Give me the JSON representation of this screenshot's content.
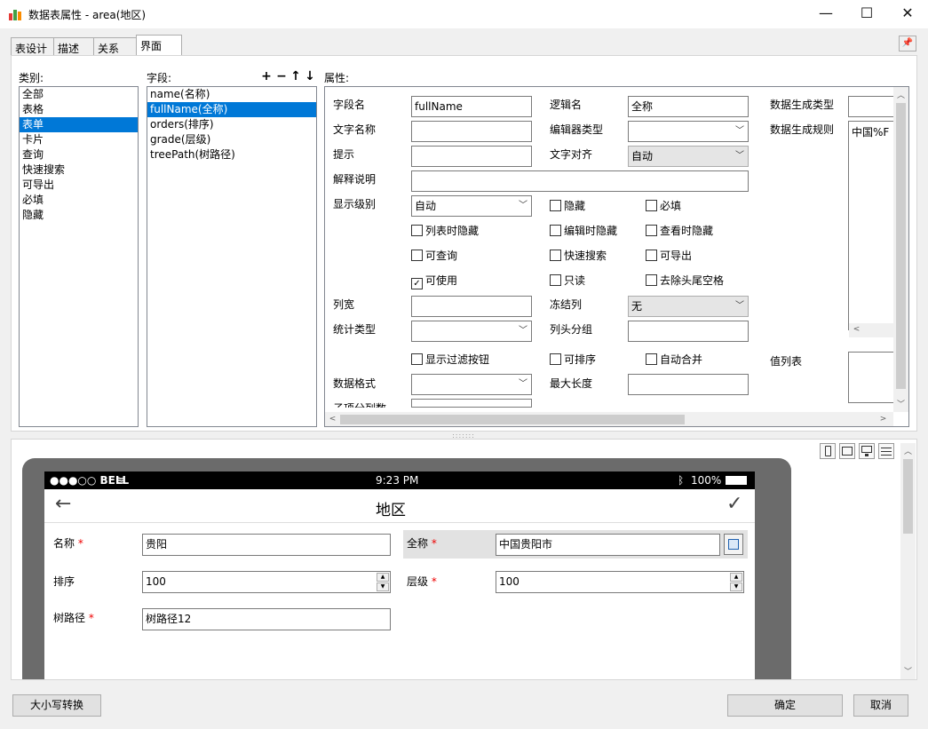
{
  "window": {
    "title": "数据表属性 - area(地区)"
  },
  "tabs": [
    {
      "label": "表设计"
    },
    {
      "label": "描述"
    },
    {
      "label": "关系"
    },
    {
      "label": "界面"
    }
  ],
  "category": {
    "label": "类别:",
    "items": [
      {
        "label": "全部"
      },
      {
        "label": "表格"
      },
      {
        "label": "表单"
      },
      {
        "label": "卡片"
      },
      {
        "label": "查询"
      },
      {
        "label": "快速搜索"
      },
      {
        "label": "可导出"
      },
      {
        "label": "必填"
      },
      {
        "label": "隐藏"
      }
    ],
    "selected_index": 2
  },
  "fields": {
    "label": "字段:",
    "items": [
      {
        "label": "name(名称)"
      },
      {
        "label": "fullName(全称)"
      },
      {
        "label": "orders(排序)"
      },
      {
        "label": "grade(层级)"
      },
      {
        "label": "treePath(树路径)"
      }
    ],
    "selected_index": 1,
    "toolbar": {
      "add": "+",
      "remove": "−",
      "up": "↑",
      "down": "↓"
    }
  },
  "props": {
    "label": "属性:",
    "field_name": {
      "label": "字段名",
      "value": "fullName"
    },
    "logic_name": {
      "label": "逻辑名",
      "value": "全称"
    },
    "gen_type": {
      "label": "数据生成类型",
      "value": ""
    },
    "text_name": {
      "label": "文字名称",
      "value": ""
    },
    "editor_type": {
      "label": "编辑器类型",
      "value": ""
    },
    "gen_rule": {
      "label": "数据生成规则",
      "value": "中国%F"
    },
    "hint": {
      "label": "提示",
      "value": ""
    },
    "text_align": {
      "label": "文字对齐",
      "value": "自动"
    },
    "explain": {
      "label": "解释说明",
      "value": ""
    },
    "show_level": {
      "label": "显示级别",
      "value": "自动"
    },
    "checks": {
      "hidden": {
        "label": "隐藏",
        "checked": false
      },
      "required": {
        "label": "必填",
        "checked": false
      },
      "hide_list": {
        "label": "列表时隐藏",
        "checked": false
      },
      "hide_edit": {
        "label": "编辑时隐藏",
        "checked": false
      },
      "hide_view": {
        "label": "查看时隐藏",
        "checked": false
      },
      "queryable": {
        "label": "可查询",
        "checked": false
      },
      "quick_search": {
        "label": "快速搜索",
        "checked": false
      },
      "exportable": {
        "label": "可导出",
        "checked": false
      },
      "usable": {
        "label": "可使用",
        "checked": true
      },
      "readonly": {
        "label": "只读",
        "checked": false
      },
      "trim": {
        "label": "去除头尾空格",
        "checked": false
      },
      "filter_btn": {
        "label": "显示过滤按钮",
        "checked": false
      },
      "sortable": {
        "label": "可排序",
        "checked": false
      },
      "auto_merge": {
        "label": "自动合并",
        "checked": false
      }
    },
    "col_width": {
      "label": "列宽",
      "value": ""
    },
    "freeze_col": {
      "label": "冻结列",
      "value": "无"
    },
    "stat_type": {
      "label": "统计类型",
      "value": ""
    },
    "header_group": {
      "label": "列头分组",
      "value": ""
    },
    "value_list": {
      "label": "值列表"
    },
    "data_format": {
      "label": "数据格式",
      "value": ""
    },
    "max_len": {
      "label": "最大长度",
      "value": ""
    },
    "sub_cols": {
      "label": "子项分列数"
    }
  },
  "preview": {
    "status": {
      "carrier": "●●●○○ BELL",
      "time": "9:23 PM",
      "battery": "100%"
    },
    "nav_title": "地区",
    "form": {
      "name": {
        "label": "名称",
        "value": "贵阳"
      },
      "full_name": {
        "label": "全称",
        "value": "中国贵阳市"
      },
      "orders": {
        "label": "排序",
        "value": "100"
      },
      "grade": {
        "label": "层级",
        "value": "100"
      },
      "tree_path": {
        "label": "树路径",
        "value": "树路径12"
      },
      "required_mark": "*"
    }
  },
  "buttons": {
    "case_convert": "大小写转换",
    "ok": "确定",
    "cancel": "取消"
  }
}
